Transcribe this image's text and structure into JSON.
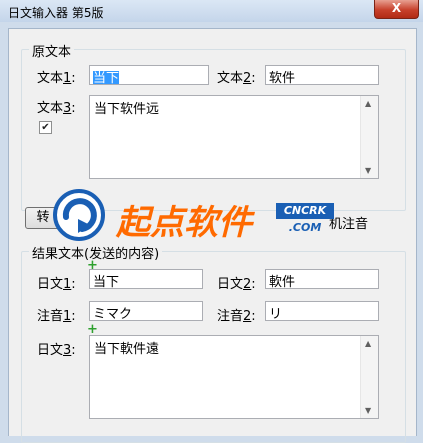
{
  "window": {
    "title": "日文输入器 第5版",
    "close_label": "X"
  },
  "source_group": {
    "legend": "原文本",
    "text1": {
      "label_pre": "文本",
      "label_u": "1",
      "label_post": ":",
      "value": "当下"
    },
    "text2": {
      "label_pre": "文本",
      "label_u": "2",
      "label_post": ":",
      "value": "软件"
    },
    "text3": {
      "label_pre": "文本",
      "label_u": "3",
      "label_post": ":",
      "value": "当下软件远"
    },
    "checkbox_mark": "✔"
  },
  "toolbar": {
    "convert_label": "转",
    "annotate_label": "机注音"
  },
  "result_group": {
    "legend": "结果文本(发送的内容)",
    "jp1": {
      "label_pre": "日文",
      "label_u": "1",
      "label_post": ":",
      "value": "当下"
    },
    "jp2": {
      "label_pre": "日文",
      "label_u": "2",
      "label_post": ":",
      "value": "軟件"
    },
    "reading1": {
      "label_pre": "注音",
      "label_u": "1",
      "label_post": ":",
      "value": "ミマク"
    },
    "reading2": {
      "label_pre": "注音",
      "label_u": "2",
      "label_post": ":",
      "value": "リ"
    },
    "jp3": {
      "label_pre": "日文",
      "label_u": "3",
      "label_post": ":",
      "value": "当下軟件遠"
    },
    "plus_mark": "+"
  },
  "watermark": {
    "name": "起点软件",
    "badge_top": "CNCRK",
    "badge_bottom": ".COM"
  }
}
